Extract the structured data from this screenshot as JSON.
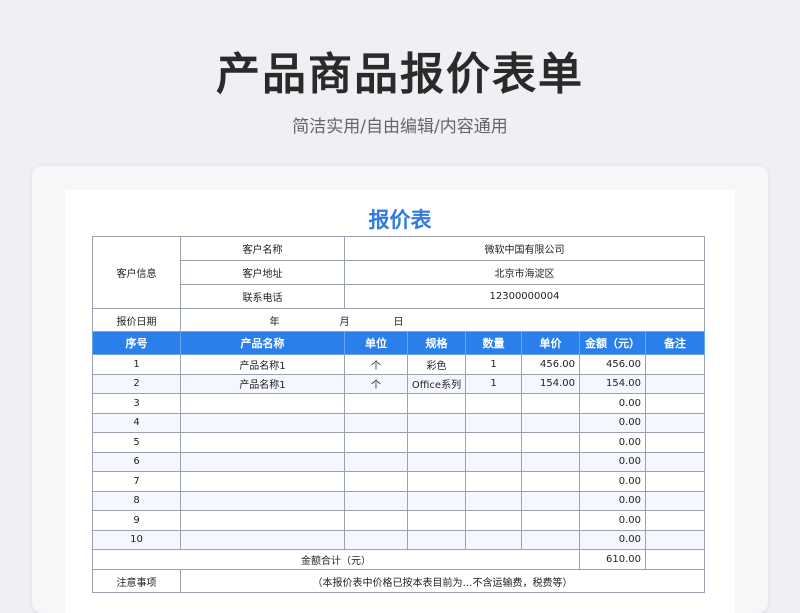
{
  "header": {
    "title": "产品商品报价表单",
    "subtitle": "简洁实用/自由编辑/内容通用"
  },
  "sheet": {
    "title": "报价表",
    "customer": {
      "section_label": "客户信息",
      "name_label": "客户名称",
      "name_value": "微软中国有限公司",
      "address_label": "客户地址",
      "address_value": "北京市海淀区",
      "phone_label": "联系电话",
      "phone_value": "12300000004"
    },
    "date": {
      "label": "报价日期",
      "year": "年",
      "month": "月",
      "day": "日"
    },
    "columns": [
      "序号",
      "产品名称",
      "单位",
      "规格",
      "数量",
      "单价",
      "金额（元）",
      "备注"
    ],
    "rows": [
      {
        "no": "1",
        "name": "产品名称1",
        "unit": "个",
        "spec": "彩色",
        "qty": "1",
        "price": "456.00",
        "amount": "456.00",
        "note": ""
      },
      {
        "no": "2",
        "name": "产品名称1",
        "unit": "个",
        "spec": "Office系列",
        "qty": "1",
        "price": "154.00",
        "amount": "154.00",
        "note": ""
      },
      {
        "no": "3",
        "name": "",
        "unit": "",
        "spec": "",
        "qty": "",
        "price": "",
        "amount": "0.00",
        "note": ""
      },
      {
        "no": "4",
        "name": "",
        "unit": "",
        "spec": "",
        "qty": "",
        "price": "",
        "amount": "0.00",
        "note": ""
      },
      {
        "no": "5",
        "name": "",
        "unit": "",
        "spec": "",
        "qty": "",
        "price": "",
        "amount": "0.00",
        "note": ""
      },
      {
        "no": "6",
        "name": "",
        "unit": "",
        "spec": "",
        "qty": "",
        "price": "",
        "amount": "0.00",
        "note": ""
      },
      {
        "no": "7",
        "name": "",
        "unit": "",
        "spec": "",
        "qty": "",
        "price": "",
        "amount": "0.00",
        "note": ""
      },
      {
        "no": "8",
        "name": "",
        "unit": "",
        "spec": "",
        "qty": "",
        "price": "",
        "amount": "0.00",
        "note": ""
      },
      {
        "no": "9",
        "name": "",
        "unit": "",
        "spec": "",
        "qty": "",
        "price": "",
        "amount": "0.00",
        "note": ""
      },
      {
        "no": "10",
        "name": "",
        "unit": "",
        "spec": "",
        "qty": "",
        "price": "",
        "amount": "0.00",
        "note": ""
      }
    ],
    "total": {
      "label": "金额合计（元）",
      "value": "610.00"
    },
    "notes": {
      "label": "注意事项",
      "text": "（本报价表中价格已按本表目前为…不含运输费，税费等）"
    }
  },
  "colors": {
    "accent": "#2a7fea",
    "title_blue": "#2f7be0",
    "page_bg": "#eef0f3"
  }
}
